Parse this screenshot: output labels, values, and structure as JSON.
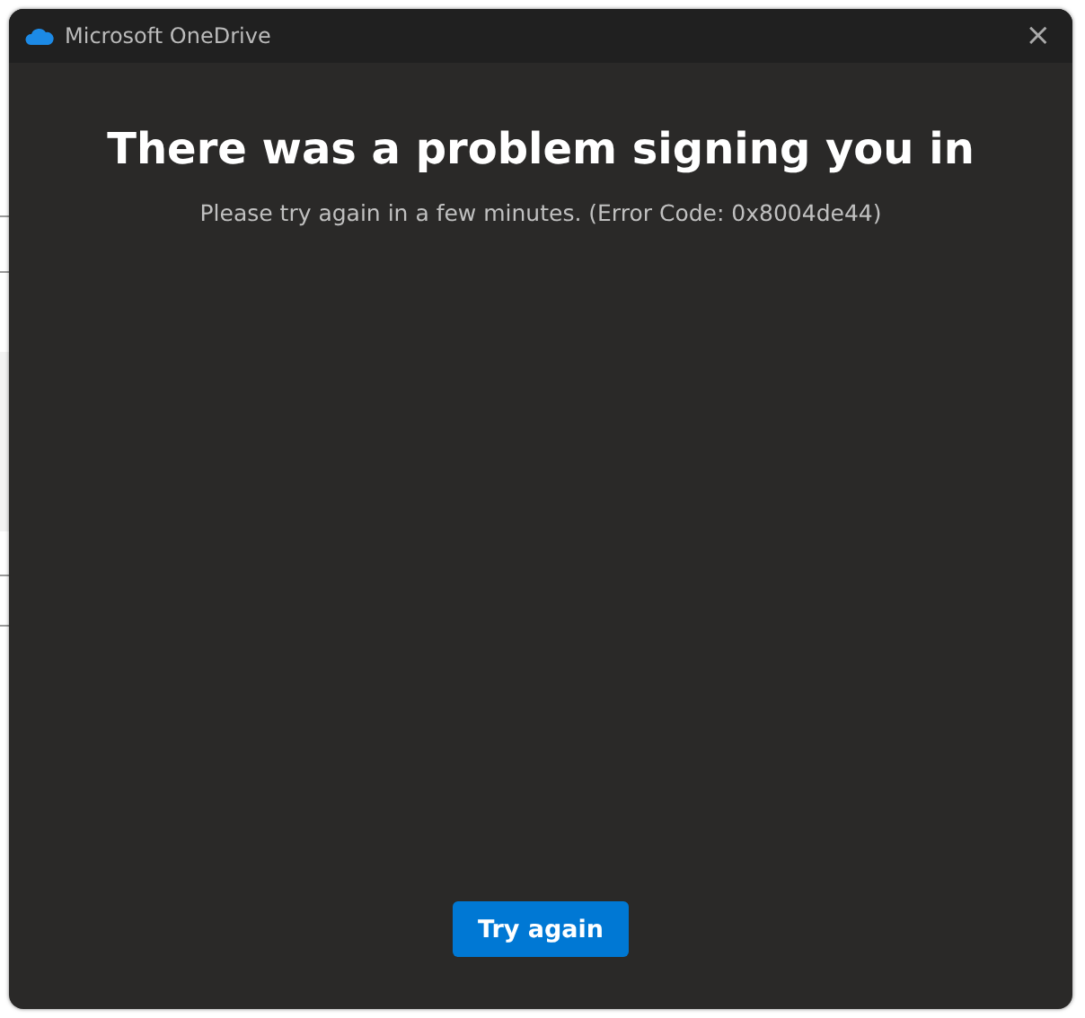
{
  "window": {
    "title": "Microsoft OneDrive",
    "close": "×"
  },
  "heading": "There was a problem signing you in",
  "message": "Please try again in a few minutes. (Error Code: 0x8004de44)",
  "buttons": [
    "Try again"
  ]
}
